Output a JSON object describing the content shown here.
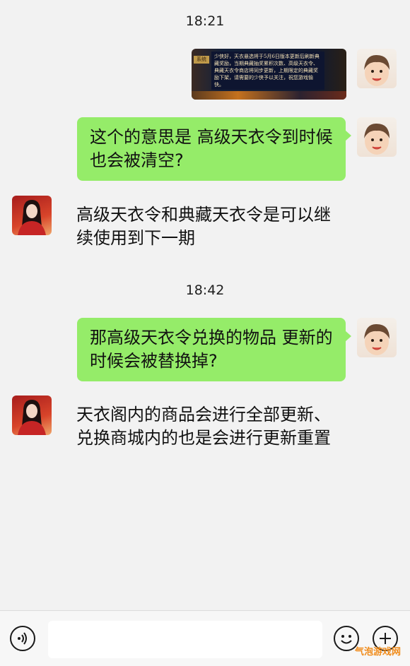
{
  "messages": {
    "time1": "18:21",
    "image_text": "少侠好，天衣悬选将于5月6日版本更新后刷新典藏奖励，当期典藏抽奖累积次数、高级天衣令、典藏天衣令商店将同步更新，上期限定的典藏奖励下架，请需要的少侠予以关注，祝您游戏愉快。",
    "image_tag": "系统",
    "q1": "这个的意思是 高级天衣令到时候也会被清空?",
    "a1": "高级天衣令和典藏天衣令是可以继续使用到下一期",
    "time2": "18:42",
    "q2": "那高级天衣令兑换的物品 更新的时候会被替换掉?",
    "a2": "天衣阁内的商品会进行全部更新、兑换商城内的也是会进行更新重置"
  },
  "input": {
    "placeholder": ""
  },
  "icons": {
    "voice": "voice-icon",
    "emoji": "emoji-icon",
    "plus": "plus-icon"
  },
  "watermark": "气泡游戏网",
  "colors": {
    "bubble_green": "#95ec69",
    "background": "#f2f2f2"
  }
}
